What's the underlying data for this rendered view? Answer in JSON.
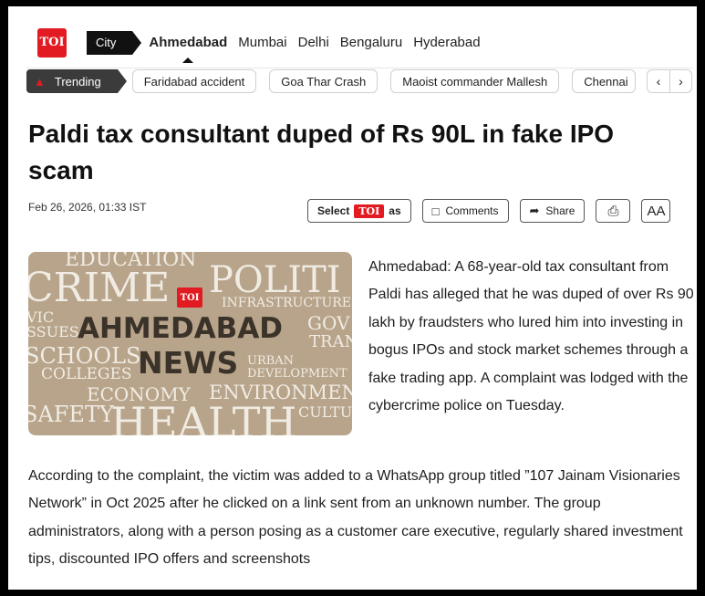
{
  "logo": {
    "text": "TOI"
  },
  "city_nav": {
    "chip": "City",
    "cities": [
      "Ahmedabad",
      "Mumbai",
      "Delhi",
      "Bengaluru",
      "Hyderabad"
    ],
    "active": "Ahmedabad"
  },
  "trending": {
    "label": "Trending",
    "items": [
      "Faridabad accident",
      "Goa Thar Crash",
      "Maoist commander Mallesh",
      "Chennai"
    ],
    "prev_icon": "chevron-left-icon",
    "next_icon": "chevron-right-icon"
  },
  "article": {
    "headline": "Paldi tax consultant duped of Rs 90L in fake IPO scam",
    "dateline": "Feb 26, 2026, 01:33 IST",
    "actions": {
      "select_prefix": "Select",
      "select_badge": "TOI",
      "select_suffix": "as",
      "comments": "Comments",
      "share": "Share",
      "font_size": "AA"
    },
    "image_words": {
      "education": "EDUCATION",
      "crime": "CRIME",
      "politi": "POLITI",
      "toi": "TOI",
      "infrastructure": "INFRASTRUCTURE",
      "vic": "VIC",
      "ssues": "SSUES",
      "ahmedabad": "AHMEDABAD",
      "gov": "GOV",
      "tran": "TRAN",
      "schools": "SCHOOLS",
      "colleges": "COLLEGES",
      "news": "NEWS",
      "urban": "URBAN",
      "development": "DEVELOPMENT",
      "economy": "ECONOMY",
      "environment": "ENVIRONMENT",
      "safety": "SAFETY",
      "health": "HEALTH",
      "cultur": "CULTUR"
    },
    "lead": "Ahmedabad: A 68-year-old tax consultant from Paldi has alleged that he was duped of over Rs 90 lakh by fraudsters who lured him into investing in bogus IPOs and stock market schemes through a fake trading app. A complaint was lodged with the cybercrime police on Tuesday.",
    "body": "According to the complaint, the victim was added to a WhatsApp group titled ”107 Jainam Visionaries Network” in Oct 2025 after he clicked on a link sent from an unknown number. The group administrators, along with a person posing as a customer care executive, regularly shared investment tips, discounted IPO offers and screenshots"
  },
  "colors": {
    "brand_red": "#e21b22",
    "nav_dark": "#111111",
    "trend_dark": "#3b3b3b"
  }
}
